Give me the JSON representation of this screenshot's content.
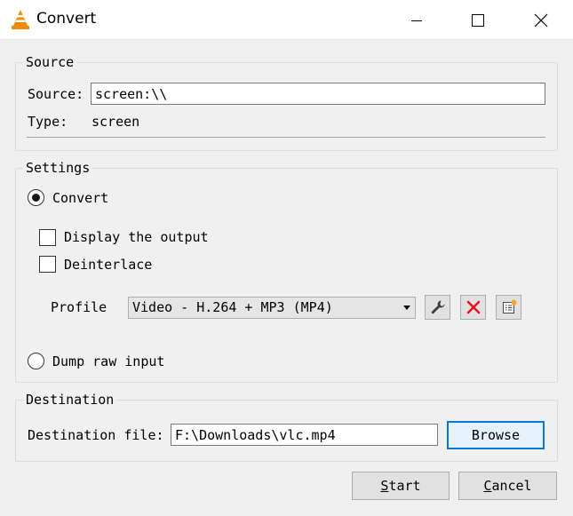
{
  "window": {
    "title": "Convert"
  },
  "source": {
    "group_title": "Source",
    "source_label": "Source:",
    "source_value": "screen:\\\\",
    "type_label": "Type:",
    "type_value": "screen"
  },
  "settings": {
    "group_title": "Settings",
    "convert_label": "Convert",
    "display_output_label": "Display the output",
    "deinterlace_label": "Deinterlace",
    "profile_label": "Profile",
    "profile_selected": "Video - H.264 + MP3 (MP4)",
    "dump_raw_label": "Dump raw input"
  },
  "destination": {
    "group_title": "Destination",
    "file_label": "Destination file:",
    "file_value": "F:\\Downloads\\vlc.mp4",
    "browse_label": "Browse"
  },
  "footer": {
    "start_first": "S",
    "start_rest": "tart",
    "cancel_first": "C",
    "cancel_rest": "ancel"
  },
  "colors": {
    "accent": "#0078d7",
    "delete_red": "#e81123",
    "vlc_orange": "#f08c00"
  }
}
